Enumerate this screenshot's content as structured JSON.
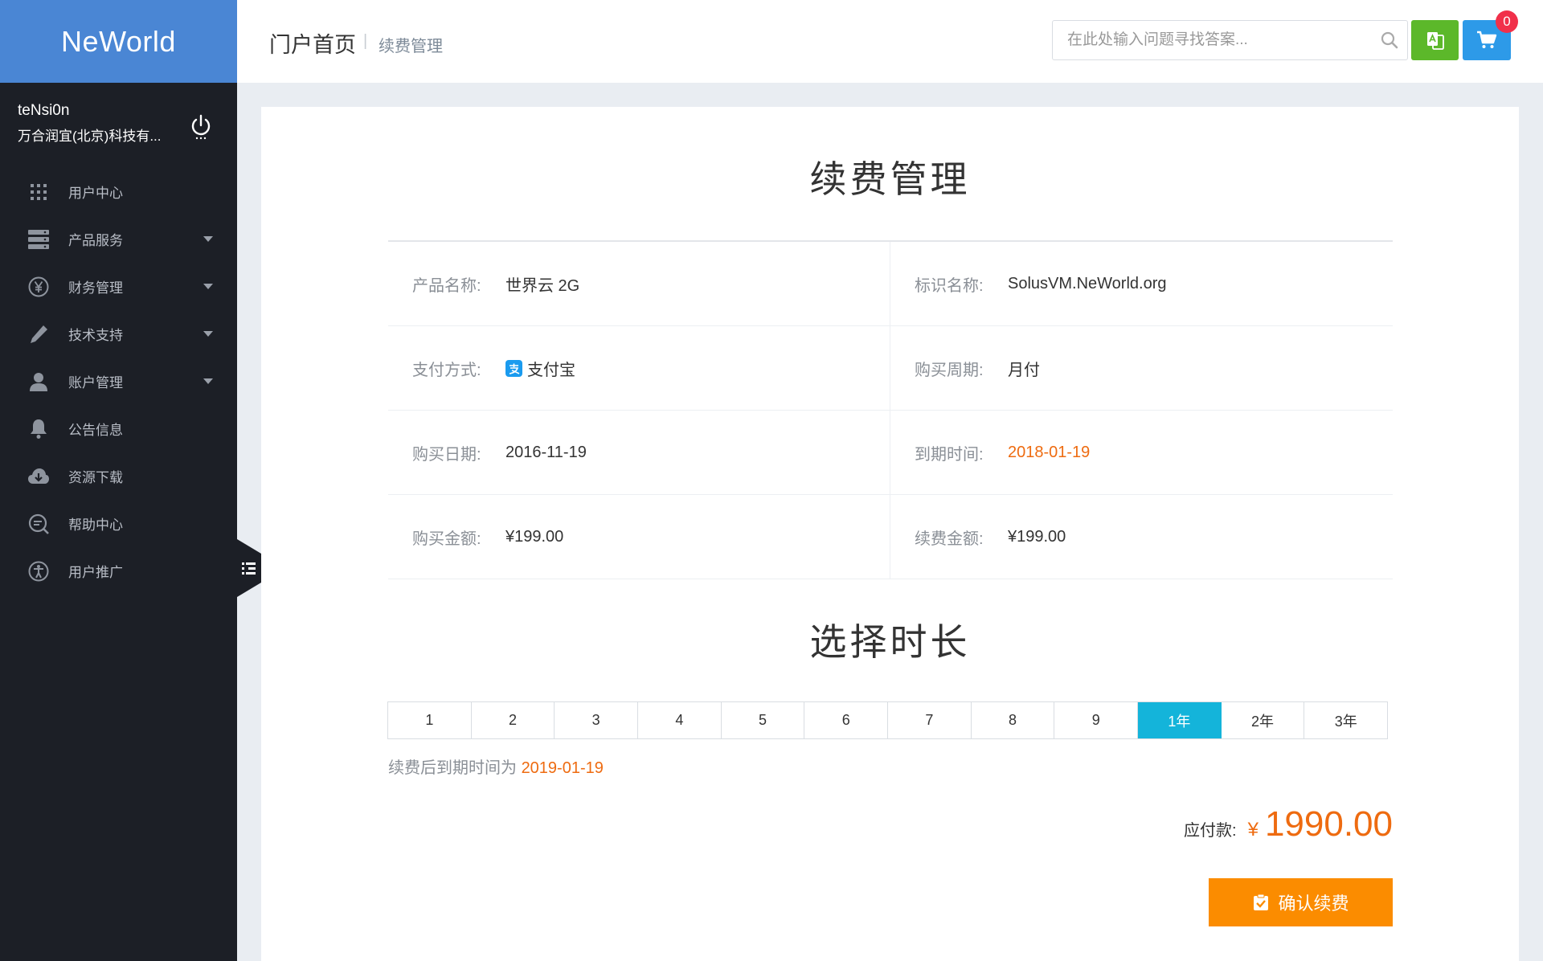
{
  "app": {
    "brand": "NeWorld"
  },
  "user": {
    "name": "teNsi0n",
    "company": "万合润宜(北京)科技有..."
  },
  "sidebar": {
    "items": [
      {
        "label": "用户中心",
        "icon": "grid-icon",
        "has_caret": false
      },
      {
        "label": "产品服务",
        "icon": "server-icon",
        "has_caret": true
      },
      {
        "label": "财务管理",
        "icon": "yen-icon",
        "has_caret": true
      },
      {
        "label": "技术支持",
        "icon": "pencil-icon",
        "has_caret": true
      },
      {
        "label": "账户管理",
        "icon": "user-icon",
        "has_caret": true
      },
      {
        "label": "公告信息",
        "icon": "bell-icon",
        "has_caret": false
      },
      {
        "label": "资源下载",
        "icon": "cloud-download-icon",
        "has_caret": false
      },
      {
        "label": "帮助中心",
        "icon": "help-search-icon",
        "has_caret": false
      },
      {
        "label": "用户推广",
        "icon": "accessibility-icon",
        "has_caret": false
      }
    ]
  },
  "header": {
    "breadcrumb_main": "门户首页",
    "breadcrumb_sep": "|",
    "breadcrumb_sub": "续费管理",
    "search_placeholder": "在此处输入问题寻找答案...",
    "cart_count": "0"
  },
  "main": {
    "title": "续费管理",
    "info": [
      {
        "left_label": "产品名称:",
        "left_value": "世界云 2G",
        "right_label": "标识名称:",
        "right_value": "SolusVM.NeWorld.org"
      },
      {
        "left_label": "支付方式:",
        "left_value": "支付宝",
        "right_label": "购买周期:",
        "right_value": "月付"
      },
      {
        "left_label": "购买日期:",
        "left_value": "2016-11-19",
        "right_label": "到期时间:",
        "right_value": "2018-01-19"
      },
      {
        "left_label": "购买金额:",
        "left_value": "¥199.00",
        "right_label": "续费金额:",
        "right_value": "¥199.00"
      }
    ],
    "duration_title": "选择时长",
    "durations": [
      "1",
      "2",
      "3",
      "4",
      "5",
      "6",
      "7",
      "8",
      "9",
      "1年",
      "2年",
      "3年"
    ],
    "selected_duration": "1年",
    "expire_note_prefix": "续费后到期时间为",
    "expire_note_date": "2019-01-19",
    "total_label": "应付款:",
    "total_currency": "¥",
    "total_amount": "1990.00",
    "confirm_label": "确认续费"
  },
  "colors": {
    "brand_blue": "#4a86d4",
    "sidebar_bg": "#1c1f26",
    "accent_orange": "#ee6b10",
    "button_orange": "#fb8c00",
    "selected_cyan": "#14b4da",
    "translate_green": "#5cb82a",
    "cart_blue": "#2d9ae8",
    "badge_red": "#f1304a"
  }
}
